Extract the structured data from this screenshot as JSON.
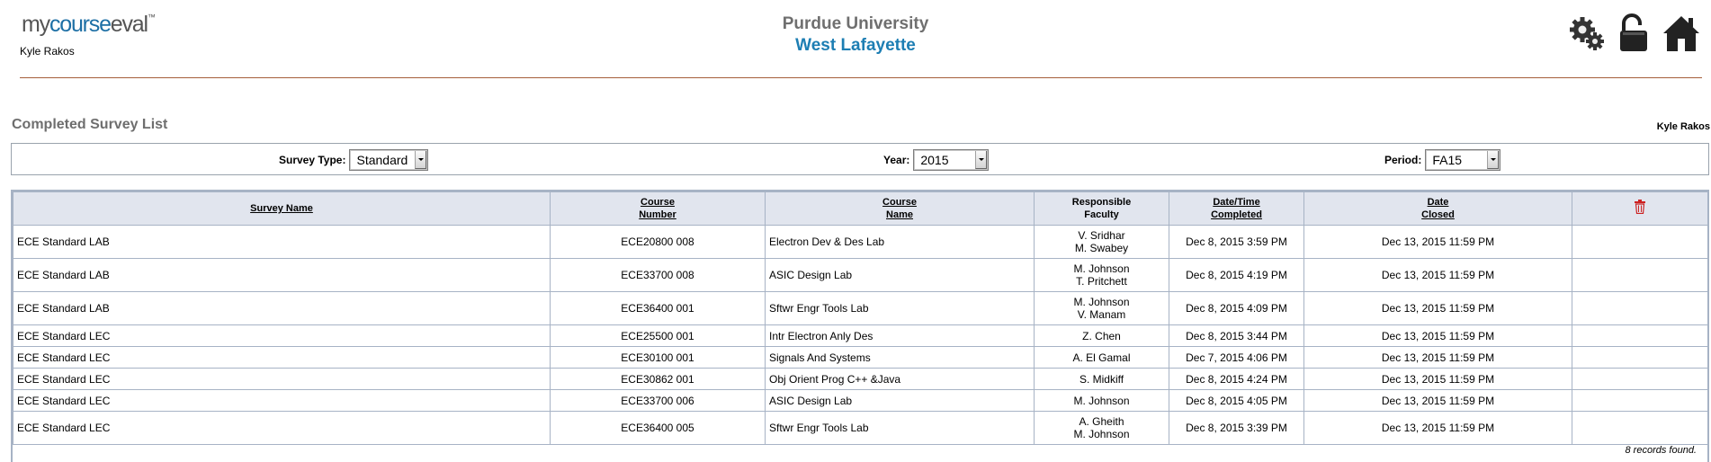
{
  "header": {
    "logo": {
      "my": "my",
      "course": "course",
      "eval": "eval",
      "tm": "™"
    },
    "user_name": "Kyle Rakos",
    "institution": "Purdue University",
    "campus": "West Lafayette",
    "icons": [
      "gears-icon",
      "lock-icon",
      "home-icon"
    ]
  },
  "page": {
    "title": "Completed Survey List",
    "user_name": "Kyle Rakos"
  },
  "filters": {
    "survey_type": {
      "label": "Survey Type:",
      "value": "Standard"
    },
    "year": {
      "label": "Year:",
      "value": "2015"
    },
    "period": {
      "label": "Period:",
      "value": "FA15"
    }
  },
  "table": {
    "headers": {
      "survey_name": "Survey Name",
      "course_number_1": "Course",
      "course_number_2": "Number",
      "course_name_1": "Course",
      "course_name_2": "Name",
      "faculty_1": "Responsible",
      "faculty_2": "Faculty",
      "completed_1": "Date/Time",
      "completed_2": "Completed",
      "closed_1": "Date",
      "closed_2": "Closed"
    },
    "rows": [
      {
        "survey": "ECE Standard LAB",
        "number": "ECE20800 008",
        "name": "Electron Dev & Des Lab",
        "faculty": [
          "V. Sridhar",
          "M. Swabey"
        ],
        "completed": "Dec 8, 2015 3:59 PM",
        "closed": "Dec 13, 2015 11:59 PM"
      },
      {
        "survey": "ECE Standard LAB",
        "number": "ECE33700 008",
        "name": "ASIC Design Lab",
        "faculty": [
          "M. Johnson",
          "T. Pritchett"
        ],
        "completed": "Dec 8, 2015 4:19 PM",
        "closed": "Dec 13, 2015 11:59 PM"
      },
      {
        "survey": "ECE Standard LAB",
        "number": "ECE36400 001",
        "name": "Sftwr Engr Tools Lab",
        "faculty": [
          "M. Johnson",
          "V. Manam"
        ],
        "completed": "Dec 8, 2015 4:09 PM",
        "closed": "Dec 13, 2015 11:59 PM"
      },
      {
        "survey": "ECE Standard LEC",
        "number": "ECE25500 001",
        "name": "Intr Electron Anly Des",
        "faculty": [
          "Z. Chen"
        ],
        "completed": "Dec 8, 2015 3:44 PM",
        "closed": "Dec 13, 2015 11:59 PM"
      },
      {
        "survey": "ECE Standard LEC",
        "number": "ECE30100 001",
        "name": "Signals And Systems",
        "faculty": [
          "A. El Gamal"
        ],
        "completed": "Dec 7, 2015 4:06 PM",
        "closed": "Dec 13, 2015 11:59 PM"
      },
      {
        "survey": "ECE Standard LEC",
        "number": "ECE30862 001",
        "name": "Obj Orient Prog C++ &Java",
        "faculty": [
          "S. Midkiff"
        ],
        "completed": "Dec 8, 2015 4:24 PM",
        "closed": "Dec 13, 2015 11:59 PM"
      },
      {
        "survey": "ECE Standard LEC",
        "number": "ECE33700 006",
        "name": "ASIC Design Lab",
        "faculty": [
          "M. Johnson"
        ],
        "completed": "Dec 8, 2015 4:05 PM",
        "closed": "Dec 13, 2015 11:59 PM"
      },
      {
        "survey": "ECE Standard LEC",
        "number": "ECE36400 005",
        "name": "Sftwr Engr Tools Lab",
        "faculty": [
          "A. Gheith",
          "M. Johnson"
        ],
        "completed": "Dec 8, 2015 3:39 PM",
        "closed": "Dec 13, 2015 11:59 PM"
      }
    ],
    "records_found": "8 records found."
  },
  "colors": {
    "logo_blue": "#1d6fa5",
    "campus_blue": "#1d7eb3",
    "divider": "#a55e3a",
    "table_header_bg": "#e1e5ee",
    "table_border": "#a7b3c5",
    "delete_red": "#cc2222"
  }
}
